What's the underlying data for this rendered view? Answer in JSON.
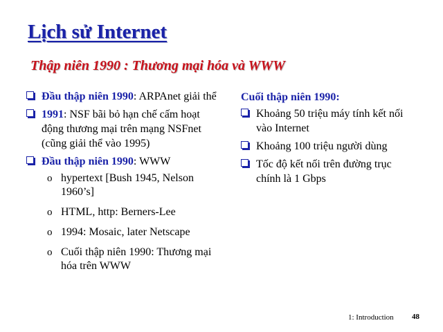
{
  "title": "Lịch sử Internet",
  "subtitle": "Thập niên 1990 : Thương mại hóa và WWW",
  "left": {
    "bullets": [
      {
        "highlight": "Đầu thập niên 1990",
        "text": ": ARPAnet giải thể"
      },
      {
        "highlight": "1991",
        "text": ": NSF bãi bỏ hạn chế cấm hoạt động thương mại trên mạng NSFnet (cũng giải thể vào 1995)"
      },
      {
        "highlight": "Đầu thập niên 1990",
        "text": ": WWW"
      }
    ],
    "sub_items": [
      "hypertext [Bush 1945, Nelson 1960’s]",
      "HTML, http: Berners-Lee",
      "1994: Mosaic, later Netscape",
      "Cuối thập niên 1990: Thương mại hóa trên WWW"
    ],
    "sub_marker": "o"
  },
  "right": {
    "heading": "Cuối thập niên 1990:",
    "bullets": [
      "Khoảng 50 triệu máy tính kết nối vào Internet",
      "Khoảng 100 triệu người dùng",
      "Tốc độ kết nối trên đường trục chính là 1 Gbps"
    ]
  },
  "footer": {
    "label": "1: Introduction",
    "page": "48"
  },
  "colors": {
    "title": "#1a22a8",
    "subtitle": "#c8101a",
    "highlight": "#1a22a8"
  }
}
